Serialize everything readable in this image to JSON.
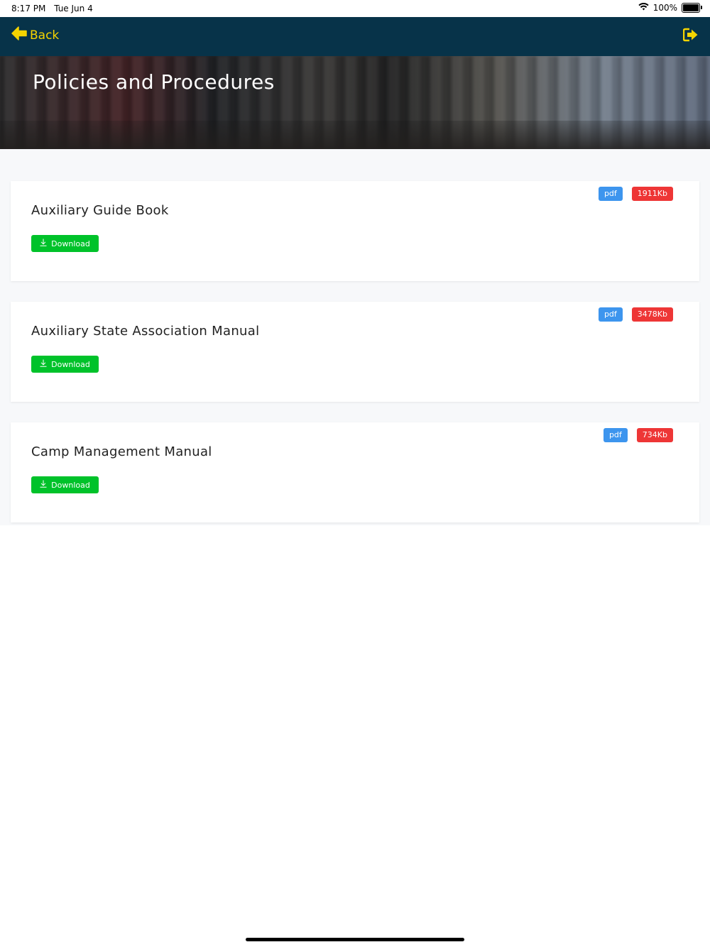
{
  "status_bar": {
    "time": "8:17 PM",
    "date": "Tue Jun 4",
    "battery_percent": "100%",
    "battery_level": 1.0,
    "icons": [
      "wifi-icon",
      "battery-icon"
    ]
  },
  "nav": {
    "back_label": "Back",
    "back_icon": "arrow-left-icon",
    "logout_icon": "sign-out-icon",
    "accent_color": "#f5d400",
    "bar_color": "#073349"
  },
  "page": {
    "title": "Policies and Procedures"
  },
  "documents": [
    {
      "title": "Auxiliary Guide Book",
      "type": "pdf",
      "size": "1911Kb",
      "download_label": "Download"
    },
    {
      "title": "Auxiliary State Association Manual",
      "type": "pdf",
      "size": "3478Kb",
      "download_label": "Download"
    },
    {
      "title": "Camp Management Manual",
      "type": "pdf",
      "size": "734Kb",
      "download_label": "Download"
    }
  ],
  "colors": {
    "type_badge": "#3d95ee",
    "size_badge": "#ee3636",
    "download_button": "#00c22a"
  }
}
